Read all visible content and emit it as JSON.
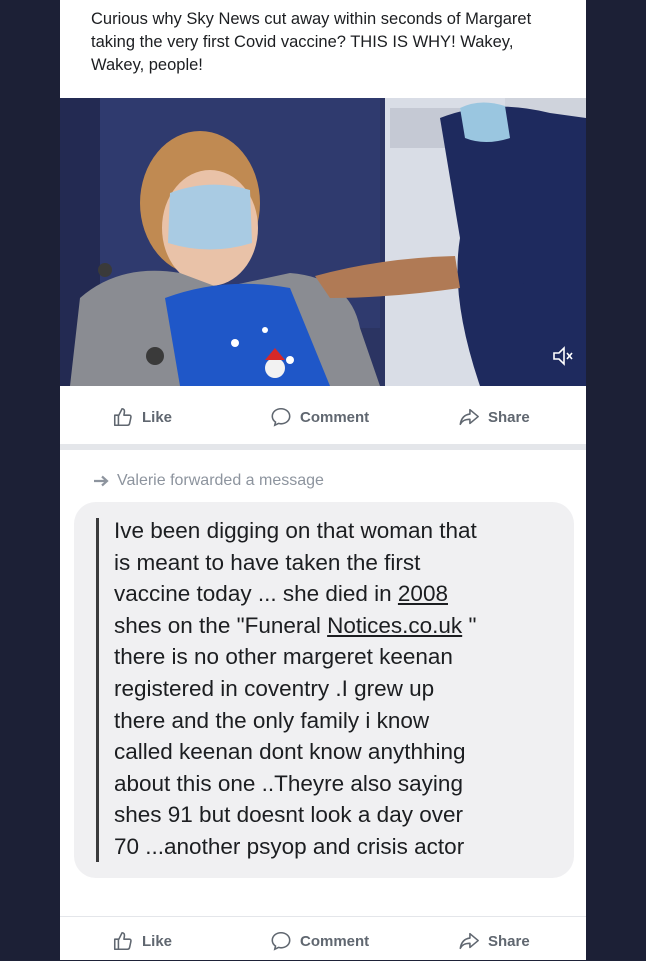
{
  "post": {
    "text": "Curious why Sky News cut away within seconds of Margaret taking the very first Covid vaccine? THIS IS WHY! Wakey, Wakey, people!"
  },
  "media": {
    "kind": "video-still",
    "mute_icon": "speaker-muted-icon"
  },
  "actions_top": {
    "like": "Like",
    "comment": "Comment",
    "share": "Share"
  },
  "forward": {
    "label": "Valerie forwarded a message"
  },
  "message": {
    "line1": "Ive been digging on that woman that",
    "line2": "is meant to have taken the first",
    "line3_a": "vaccine today ... she died in ",
    "line3_u": "2008",
    "line4_a": "shes on the \"Funeral ",
    "line4_u": "Notices.co.uk",
    "line4_b": " \"",
    "line5": "there is no other margeret keenan",
    "line6": "registered in coventry .I grew up",
    "line7": "there and the only family i know",
    "line8": "called keenan dont know anythhing",
    "line9": "about this one ..Theyre also saying",
    "line10": "shes 91 but doesnt look a day over",
    "line11": "70 ...another psyop and crisis actor"
  },
  "actions_bottom": {
    "like": "Like",
    "comment": "Comment",
    "share": "Share"
  },
  "colors": {
    "background": "#1e2238",
    "card": "#ffffff",
    "bubble": "#f0f0f2",
    "action_text": "#606770"
  }
}
